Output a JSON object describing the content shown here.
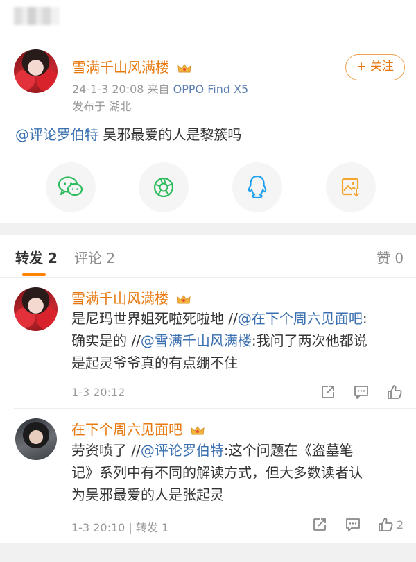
{
  "post": {
    "author": "雪满千山风满楼",
    "time_device_prefix": "24-1-3 20:08  来自",
    "device": "OPPO Find X5",
    "location": "发布于 湖北",
    "follow_label": "+ 关注",
    "mention": "@评论罗伯特",
    "text": " 吴邪最爱的人是黎簇吗"
  },
  "share": {
    "items": [
      "wechat-icon",
      "moments-icon",
      "qq-icon",
      "save-image-icon"
    ]
  },
  "tabs": {
    "repost": "转发 2",
    "comment": "评论 2",
    "like": "赞 0"
  },
  "comments": [
    {
      "author": "雪满千山风满楼",
      "line1a": "是尼玛世界姐死啦死啦地 //",
      "line1m": "@在下个周六见面吧",
      "line1b": ":",
      "line2a": "确实是的 //",
      "line2m": "@雪满千山风满楼",
      "line2b": ":我问了两次他都说",
      "line3": "是起灵爷爷真的有点绷不住",
      "time": "1-3 20:12",
      "likes": ""
    },
    {
      "author": "在下个周六见面吧",
      "line1a": "劳资喷了 //",
      "line1m": "@评论罗伯特",
      "line1b": ":这个问题在《盗墓笔",
      "line2": "记》系列中有不同的解读方式，但大多数读者认",
      "line3": "为吴邪最爱的人是张起灵",
      "time": "1-3 20:10 | 转发 1",
      "likes": "2"
    }
  ],
  "colors": {
    "accent": "#e8780e",
    "mention": "#3a6fb0",
    "tab_underline": "#ff8200"
  }
}
